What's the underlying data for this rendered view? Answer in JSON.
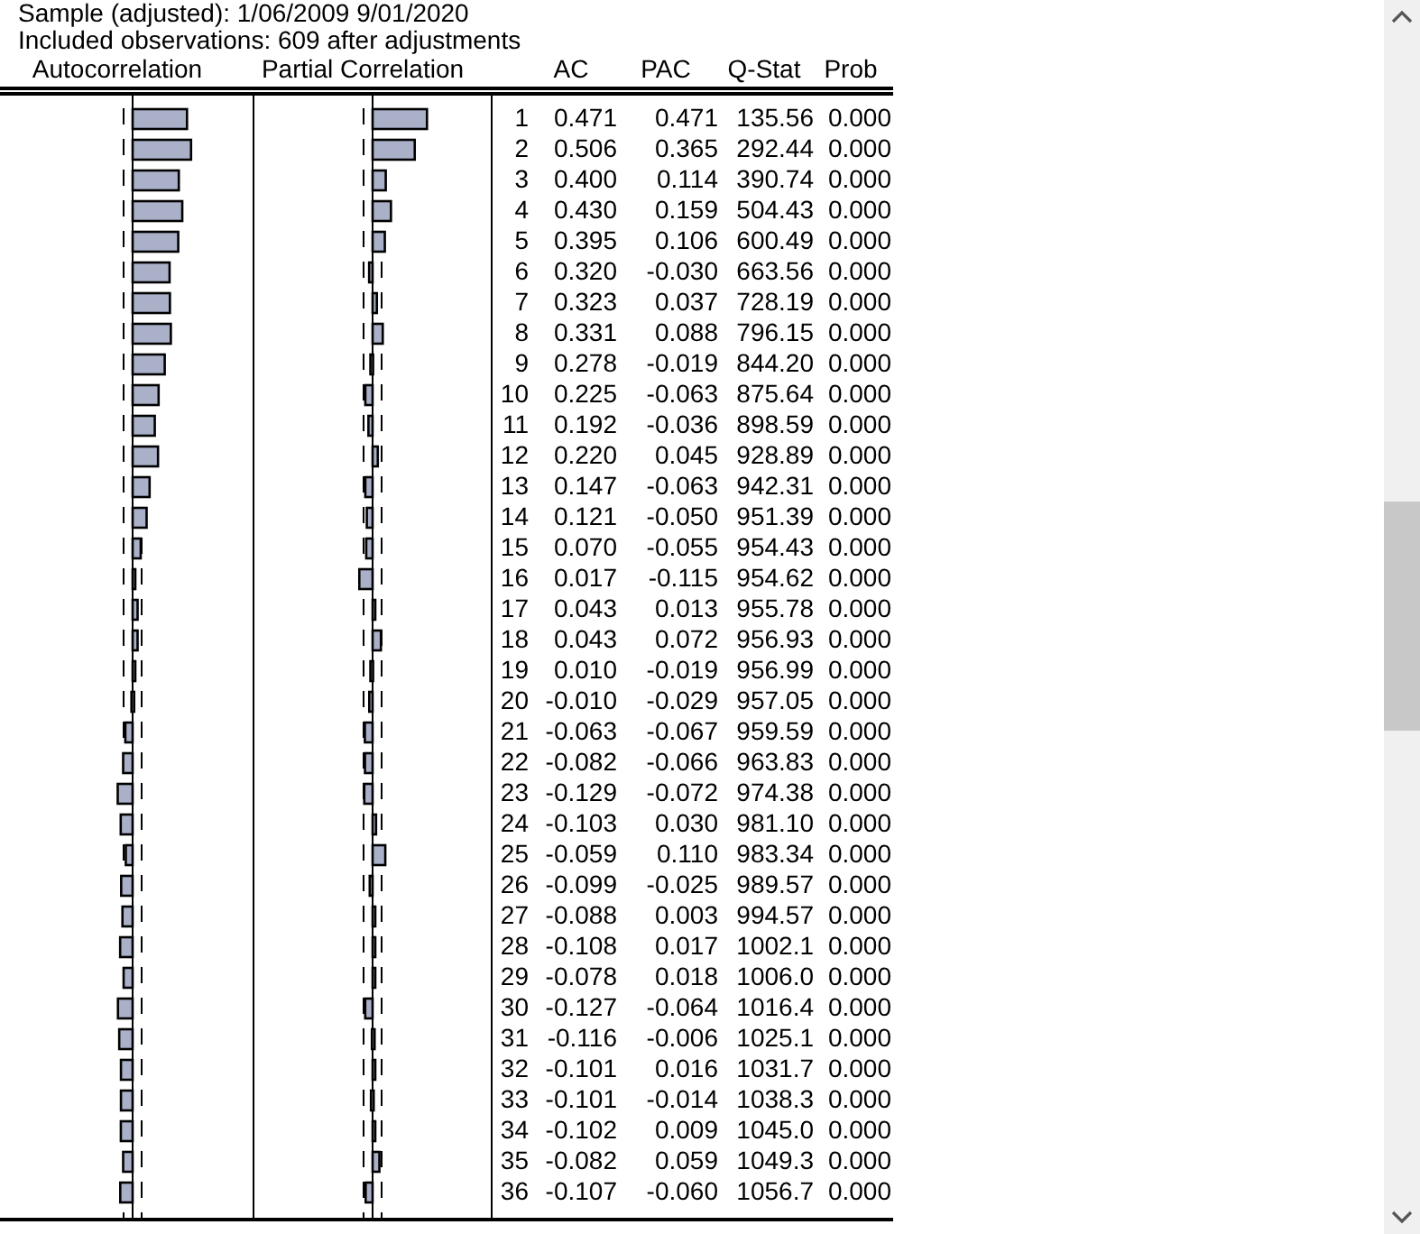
{
  "sample_line": "Sample (adjusted): 1/06/2009 9/01/2020",
  "observations_line": "Included observations: 609 after adjustments",
  "columns": [
    "Autocorrelation",
    "Partial Correlation",
    "AC",
    "PAC",
    "Q-Stat",
    "Prob"
  ],
  "rows": [
    {
      "lag": "1",
      "ac": "0.471",
      "pac": "0.471",
      "q_stat": "135.56",
      "prob": "0.000"
    },
    {
      "lag": "2",
      "ac": "0.506",
      "pac": "0.365",
      "q_stat": "292.44",
      "prob": "0.000"
    },
    {
      "lag": "3",
      "ac": "0.400",
      "pac": "0.114",
      "q_stat": "390.74",
      "prob": "0.000"
    },
    {
      "lag": "4",
      "ac": "0.430",
      "pac": "0.159",
      "q_stat": "504.43",
      "prob": "0.000"
    },
    {
      "lag": "5",
      "ac": "0.395",
      "pac": "0.106",
      "q_stat": "600.49",
      "prob": "0.000"
    },
    {
      "lag": "6",
      "ac": "0.320",
      "pac": "-0.030",
      "q_stat": "663.56",
      "prob": "0.000"
    },
    {
      "lag": "7",
      "ac": "0.323",
      "pac": "0.037",
      "q_stat": "728.19",
      "prob": "0.000"
    },
    {
      "lag": "8",
      "ac": "0.331",
      "pac": "0.088",
      "q_stat": "796.15",
      "prob": "0.000"
    },
    {
      "lag": "9",
      "ac": "0.278",
      "pac": "-0.019",
      "q_stat": "844.20",
      "prob": "0.000"
    },
    {
      "lag": "10",
      "ac": "0.225",
      "pac": "-0.063",
      "q_stat": "875.64",
      "prob": "0.000"
    },
    {
      "lag": "11",
      "ac": "0.192",
      "pac": "-0.036",
      "q_stat": "898.59",
      "prob": "0.000"
    },
    {
      "lag": "12",
      "ac": "0.220",
      "pac": "0.045",
      "q_stat": "928.89",
      "prob": "0.000"
    },
    {
      "lag": "13",
      "ac": "0.147",
      "pac": "-0.063",
      "q_stat": "942.31",
      "prob": "0.000"
    },
    {
      "lag": "14",
      "ac": "0.121",
      "pac": "-0.050",
      "q_stat": "951.39",
      "prob": "0.000"
    },
    {
      "lag": "15",
      "ac": "0.070",
      "pac": "-0.055",
      "q_stat": "954.43",
      "prob": "0.000"
    },
    {
      "lag": "16",
      "ac": "0.017",
      "pac": "-0.115",
      "q_stat": "954.62",
      "prob": "0.000"
    },
    {
      "lag": "17",
      "ac": "0.043",
      "pac": "0.013",
      "q_stat": "955.78",
      "prob": "0.000"
    },
    {
      "lag": "18",
      "ac": "0.043",
      "pac": "0.072",
      "q_stat": "956.93",
      "prob": "0.000"
    },
    {
      "lag": "19",
      "ac": "0.010",
      "pac": "-0.019",
      "q_stat": "956.99",
      "prob": "0.000"
    },
    {
      "lag": "20",
      "ac": "-0.010",
      "pac": "-0.029",
      "q_stat": "957.05",
      "prob": "0.000"
    },
    {
      "lag": "21",
      "ac": "-0.063",
      "pac": "-0.067",
      "q_stat": "959.59",
      "prob": "0.000"
    },
    {
      "lag": "22",
      "ac": "-0.082",
      "pac": "-0.066",
      "q_stat": "963.83",
      "prob": "0.000"
    },
    {
      "lag": "23",
      "ac": "-0.129",
      "pac": "-0.072",
      "q_stat": "974.38",
      "prob": "0.000"
    },
    {
      "lag": "24",
      "ac": "-0.103",
      "pac": "0.030",
      "q_stat": "981.10",
      "prob": "0.000"
    },
    {
      "lag": "25",
      "ac": "-0.059",
      "pac": "0.110",
      "q_stat": "983.34",
      "prob": "0.000"
    },
    {
      "lag": "26",
      "ac": "-0.099",
      "pac": "-0.025",
      "q_stat": "989.57",
      "prob": "0.000"
    },
    {
      "lag": "27",
      "ac": "-0.088",
      "pac": "0.003",
      "q_stat": "994.57",
      "prob": "0.000"
    },
    {
      "lag": "28",
      "ac": "-0.108",
      "pac": "0.017",
      "q_stat": "1002.1",
      "prob": "0.000"
    },
    {
      "lag": "29",
      "ac": "-0.078",
      "pac": "0.018",
      "q_stat": "1006.0",
      "prob": "0.000"
    },
    {
      "lag": "30",
      "ac": "-0.127",
      "pac": "-0.064",
      "q_stat": "1016.4",
      "prob": "0.000"
    },
    {
      "lag": "31",
      "ac": "-0.116",
      "pac": "-0.006",
      "q_stat": "1025.1",
      "prob": "0.000"
    },
    {
      "lag": "32",
      "ac": "-0.101",
      "pac": "0.016",
      "q_stat": "1031.7",
      "prob": "0.000"
    },
    {
      "lag": "33",
      "ac": "-0.101",
      "pac": "-0.014",
      "q_stat": "1038.3",
      "prob": "0.000"
    },
    {
      "lag": "34",
      "ac": "-0.102",
      "pac": "0.009",
      "q_stat": "1045.0",
      "prob": "0.000"
    },
    {
      "lag": "35",
      "ac": "-0.082",
      "pac": "0.059",
      "q_stat": "1049.3",
      "prob": "0.000"
    },
    {
      "lag": "36",
      "ac": "-0.107",
      "pac": "-0.060",
      "q_stat": "1056.7",
      "prob": "0.000"
    }
  ]
}
